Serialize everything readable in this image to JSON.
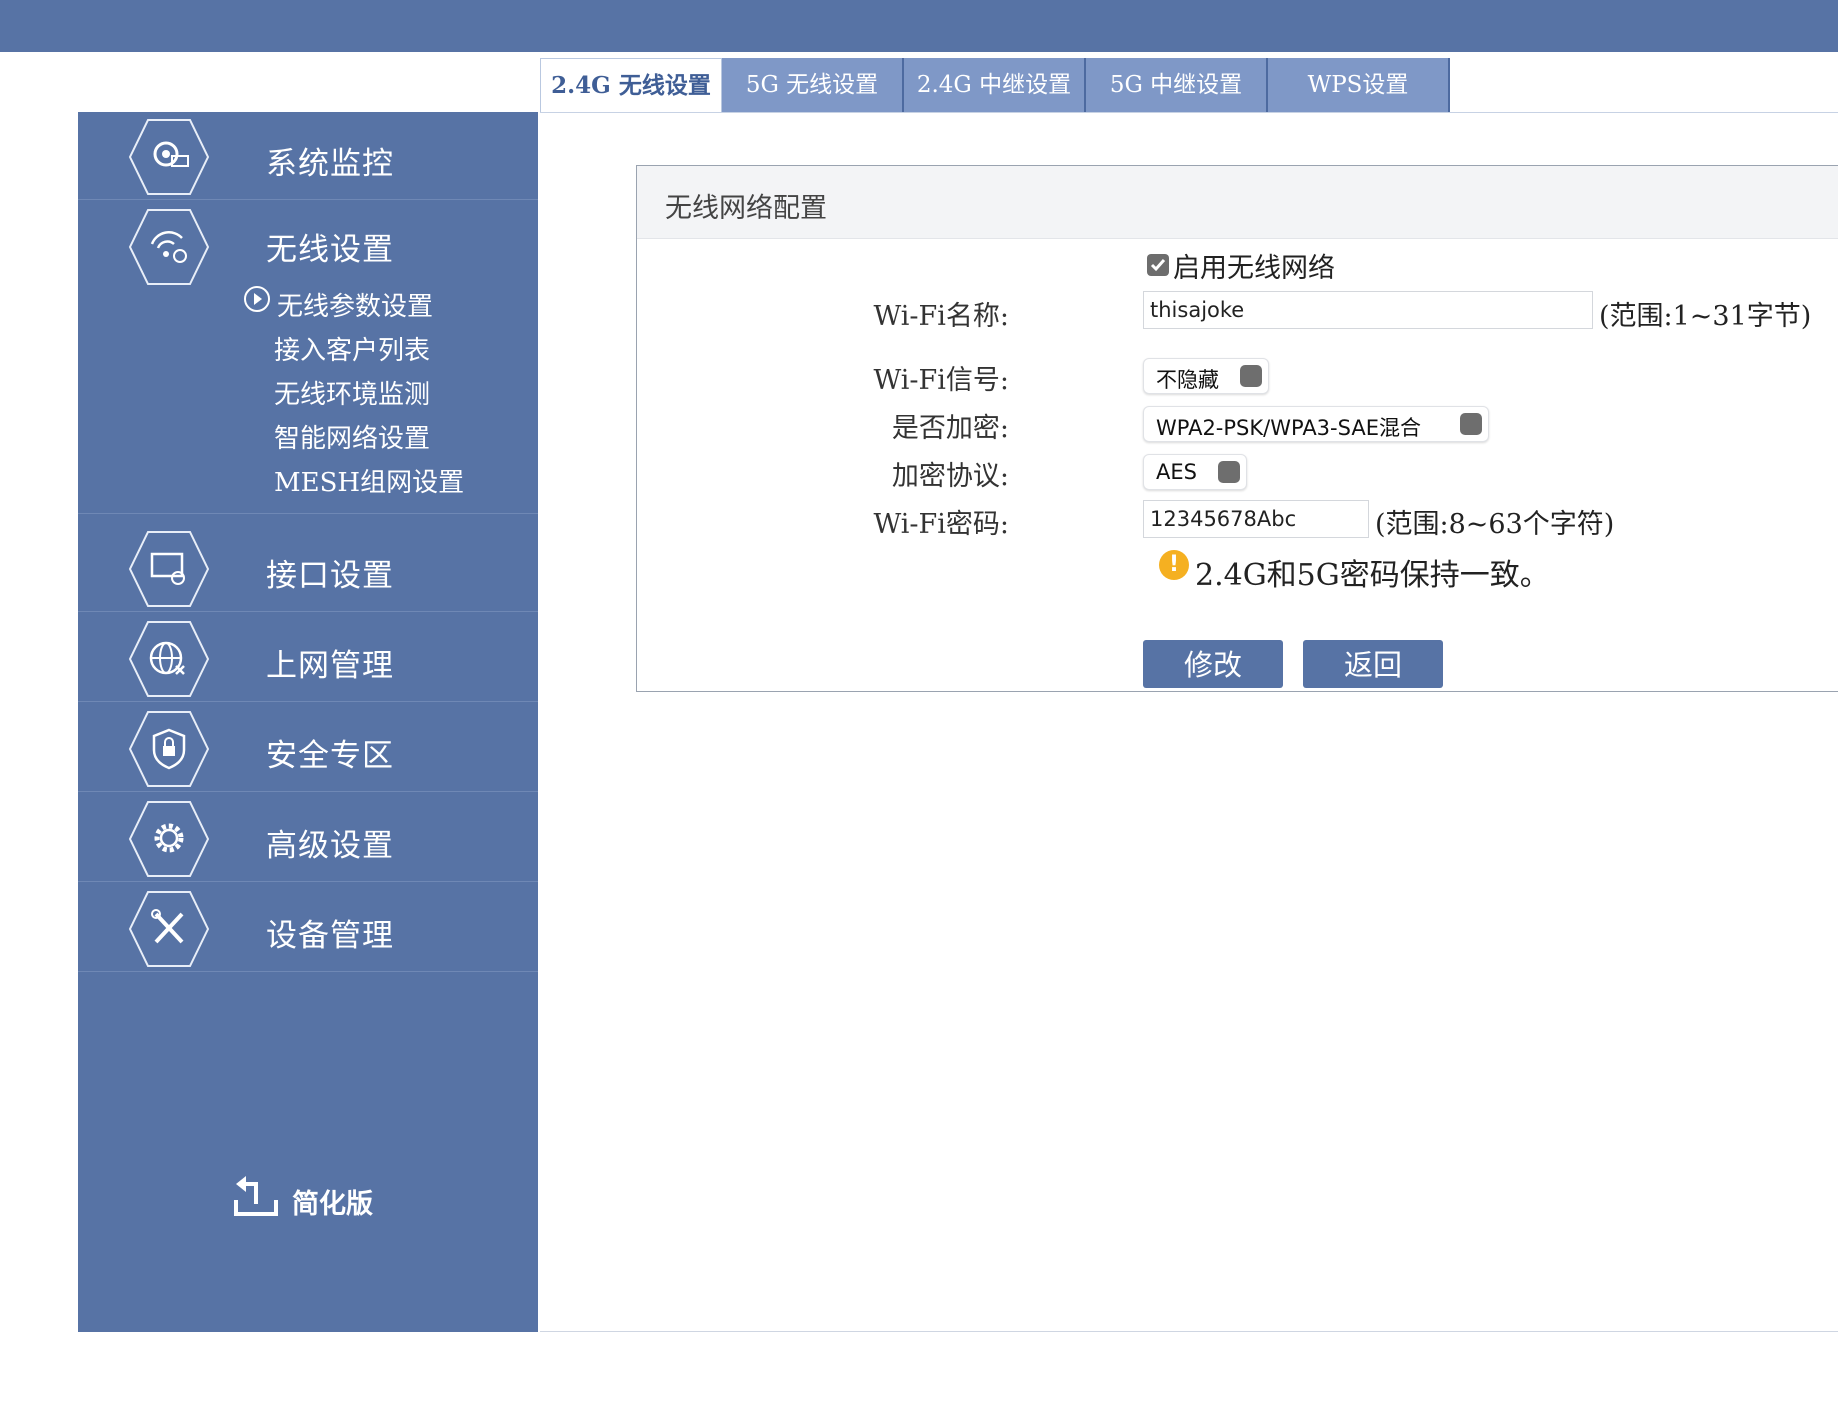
{
  "tabs": [
    "2.4G 无线设置",
    "5G 无线设置",
    "2.4G 中继设置",
    "5G 中继设置",
    "WPS设置"
  ],
  "sidebar": {
    "items": [
      {
        "label": "系统监控",
        "icon": "monitor-gear-icon"
      },
      {
        "label": "无线设置",
        "icon": "wifi-gear-icon"
      },
      {
        "label": "接口设置",
        "icon": "interface-gear-icon"
      },
      {
        "label": "上网管理",
        "icon": "globe-icon"
      },
      {
        "label": "安全专区",
        "icon": "shield-lock-icon"
      },
      {
        "label": "高级设置",
        "icon": "gear-icon"
      },
      {
        "label": "设备管理",
        "icon": "tools-icon"
      }
    ],
    "sub_items": [
      "无线参数设置",
      "接入客户列表",
      "无线环境监测",
      "智能网络设置",
      "MESH组网设置"
    ],
    "simple_version": "简化版"
  },
  "panel": {
    "title": "无线网络配置",
    "enable_wifi": {
      "label": "启用无线网络",
      "checked": true
    },
    "wifi_name": {
      "label": "Wi-Fi名称:",
      "value": "thisajoke",
      "hint": "(范围:1~31字节)"
    },
    "wifi_signal": {
      "label": "Wi-Fi信号:",
      "value": "不隐藏"
    },
    "encryption": {
      "label": "是否加密:",
      "value": "WPA2-PSK/WPA3-SAE混合"
    },
    "protocol": {
      "label": "加密协议:",
      "value": "AES"
    },
    "password": {
      "label": "Wi-Fi密码:",
      "value": "12345678Abc",
      "hint": "(范围:8~63个字符)"
    },
    "notice": "2.4G和5G密码保持一致。",
    "modify_button": "修改",
    "back_button": "返回"
  },
  "colors": {
    "primary": "#5773a5",
    "tab_inactive": "#7f98c7",
    "warning": "#f5b021"
  }
}
